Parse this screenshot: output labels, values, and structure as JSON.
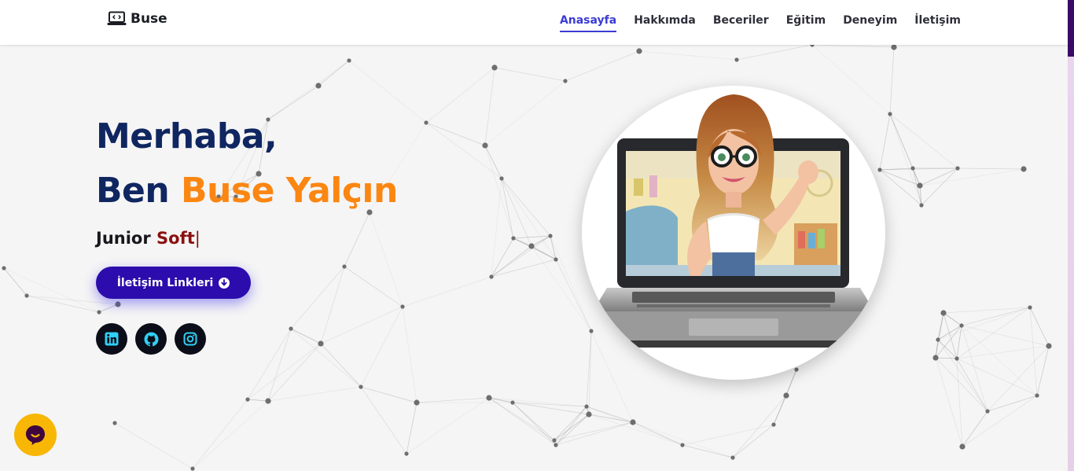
{
  "nav": {
    "brand": "Buse",
    "brand_icon": "laptop-code-icon",
    "links": [
      "Anasayfa",
      "Hakkımda",
      "Beceriler",
      "Eğitim",
      "Deneyim",
      "İletişim"
    ],
    "active": "Anasayfa"
  },
  "hero": {
    "greeting": "Merhaba,",
    "intro": "Ben",
    "name": "Buse Yalçın",
    "subtitle_prefix": "Junior",
    "subtitle_typed": "Soft",
    "cursor": "|",
    "cta_label": "İletişim Linkleri",
    "cta_icon": "arrow-circle-down-icon"
  },
  "socials": [
    {
      "icon": "linkedin-icon"
    },
    {
      "icon": "github-icon"
    },
    {
      "icon": "instagram-icon"
    }
  ],
  "avatar": {
    "icon": "laptop-avatar-illustration"
  },
  "chat": {
    "icon": "chat-bubble-icon"
  },
  "colors": {
    "navy": "#0f2660",
    "orange": "#fb8612",
    "dark_red": "#8b1010",
    "button": "#2c0cac",
    "active_link": "#3b3bd6",
    "social_bg": "#0b0d18",
    "social_icon": "#2fd0f5",
    "chat": "#f8b705"
  }
}
